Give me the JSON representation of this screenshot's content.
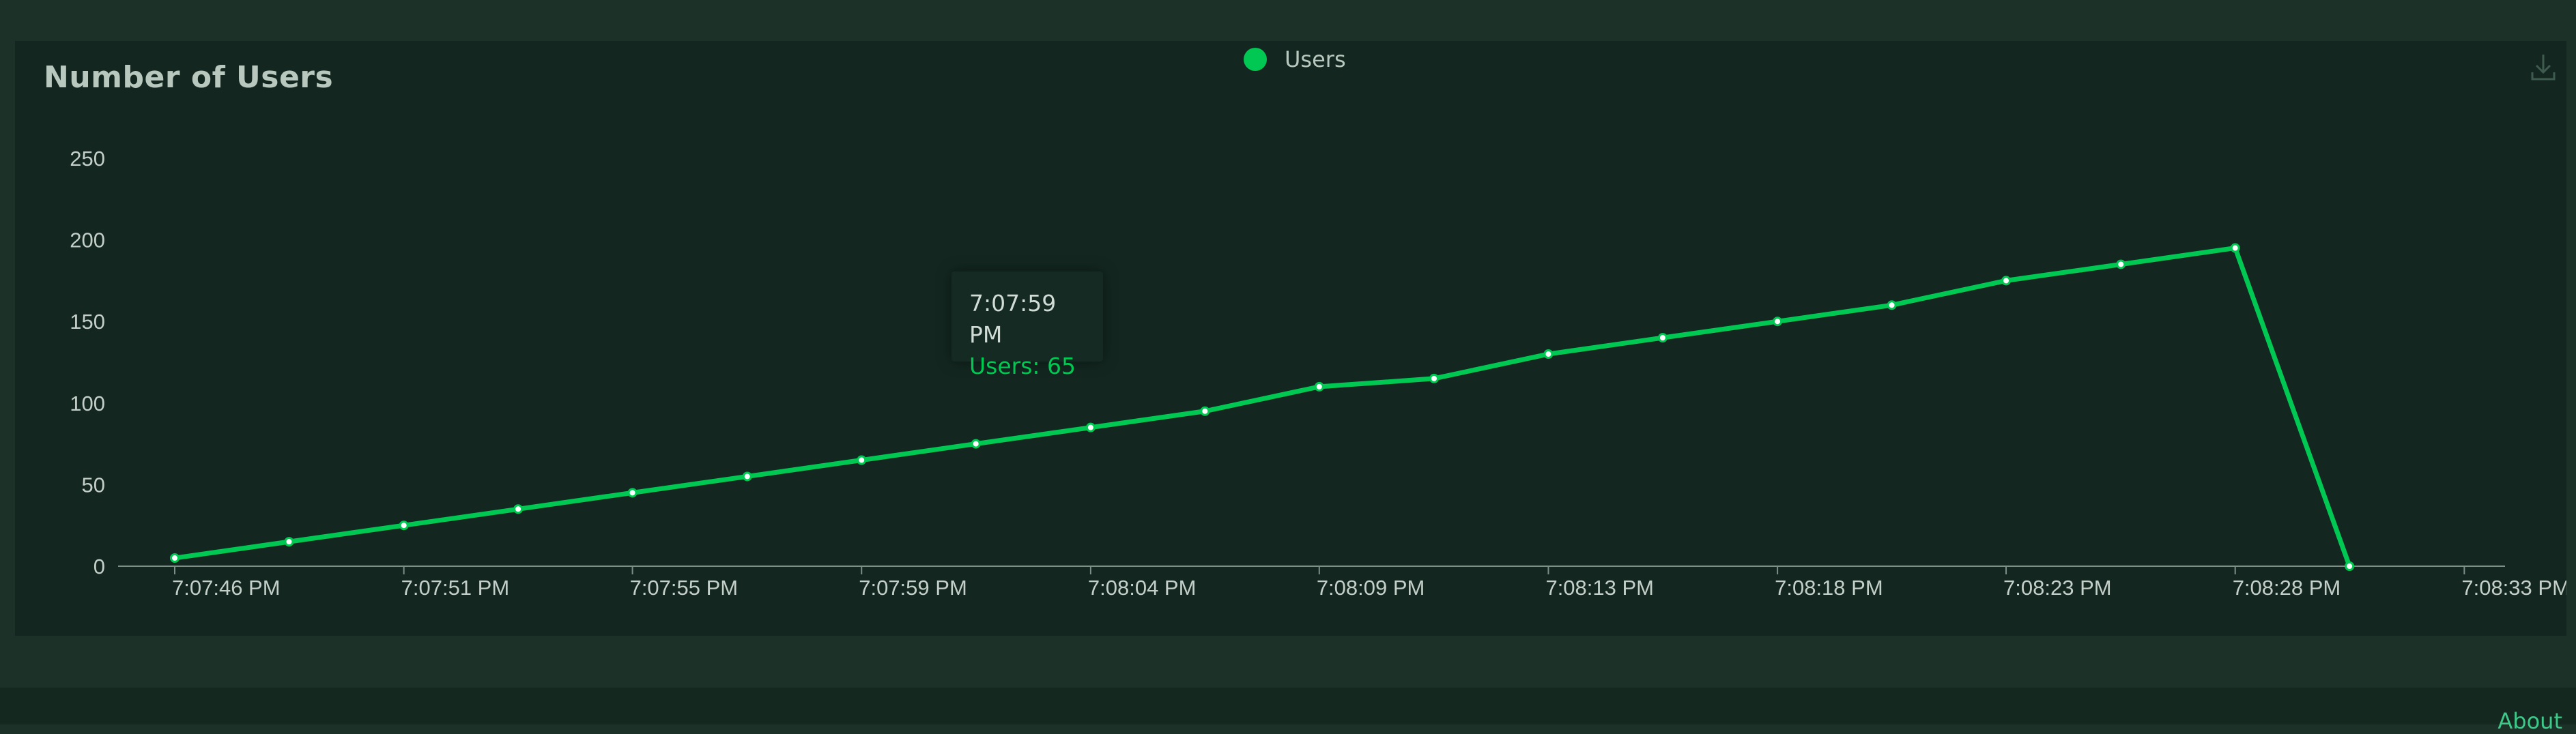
{
  "panel": {
    "title": "Number of Users"
  },
  "legend": {
    "label": "Users",
    "color": "#00c853"
  },
  "toolbar": {
    "download_icon": "download-icon"
  },
  "tooltip": {
    "time": "7:07:59 PM",
    "value_text": "Users: 65"
  },
  "footer": {
    "link_label": "About"
  },
  "chart_data": {
    "type": "line",
    "title": "Number of Users",
    "xlabel": "",
    "ylabel": "",
    "ylim": [
      0,
      250
    ],
    "yticks": [
      0,
      50,
      100,
      150,
      200,
      250
    ],
    "xlim_seconds": [
      0,
      47.5
    ],
    "x_tick_labels": [
      "7:07:46 PM",
      "7:07:51 PM",
      "7:07:55 PM",
      "7:07:59 PM",
      "7:08:04 PM",
      "7:08:09 PM",
      "7:08:13 PM",
      "7:08:18 PM",
      "7:08:23 PM",
      "7:08:28 PM",
      "7:08:33 PM"
    ],
    "x_tick_seconds": [
      0,
      4.67,
      9.33,
      14,
      18.67,
      23.33,
      28,
      32.67,
      37.33,
      42,
      46.67
    ],
    "grid": false,
    "legend_position": "top-center",
    "series": [
      {
        "name": "Users",
        "color": "#00c853",
        "x_seconds": [
          0,
          2.33,
          4.67,
          7,
          9.33,
          11.67,
          14,
          16.33,
          18.67,
          21,
          23.33,
          25.67,
          28,
          30.33,
          32.67,
          35,
          37.33,
          39.67,
          42,
          44.33
        ],
        "values": [
          5,
          15,
          25,
          35,
          45,
          55,
          65,
          75,
          85,
          95,
          110,
          115,
          130,
          140,
          150,
          160,
          175,
          185,
          195,
          0
        ]
      }
    ]
  }
}
